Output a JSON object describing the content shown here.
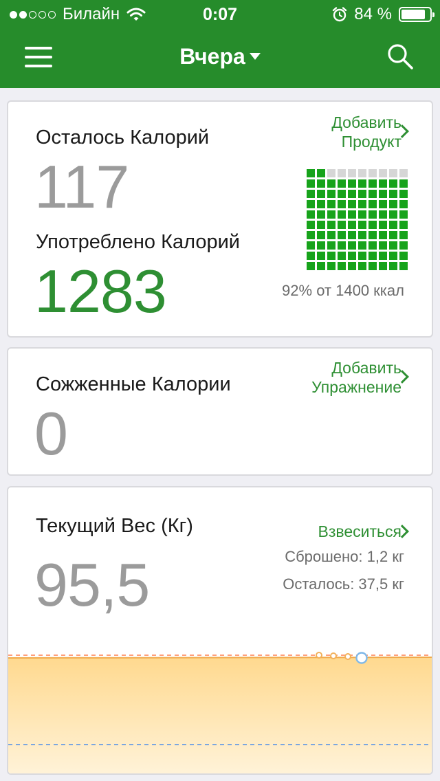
{
  "colors": {
    "brand": "#268c2b",
    "accent": "#2e8f33",
    "chart_fill_top": "#ffd98f",
    "chart_fill_bottom": "#fff4dc",
    "target_line": "#ff9f7a",
    "goal_line": "#7aa6e0",
    "point": "#f2b05a",
    "current_point": "#7fb8e8"
  },
  "status_bar": {
    "carrier": "Билайн",
    "time": "0:07",
    "battery": "84 %",
    "battery_level": 0.84,
    "signal_filled": 2,
    "signal_total": 5,
    "icons": [
      "wifi-icon",
      "alarm-icon",
      "battery-icon"
    ]
  },
  "header": {
    "title": "Вчера",
    "menu_icon": "hamburger-menu-icon",
    "search_icon": "search-icon"
  },
  "calories_card": {
    "remaining_label": "Осталось Калорий",
    "remaining_value": "117",
    "consumed_label": "Употреблено Калорий",
    "consumed_value": "1283",
    "action_line1": "Добавить",
    "action_line2": "Продукт",
    "percent_text": "92% от 1400 ккал",
    "grid_total": 100,
    "grid_filled": 92
  },
  "burned_card": {
    "label": "Сожженные Калории",
    "value": "0",
    "action_line1": "Добавить",
    "action_line2": "Упражнение"
  },
  "weight_card": {
    "label": "Текущий Вес (Кг)",
    "value": "95,5",
    "action": "Взвеситься",
    "lost": "Сброшено: 1,2 кг",
    "left": "Осталось: 37,5 кг"
  }
}
